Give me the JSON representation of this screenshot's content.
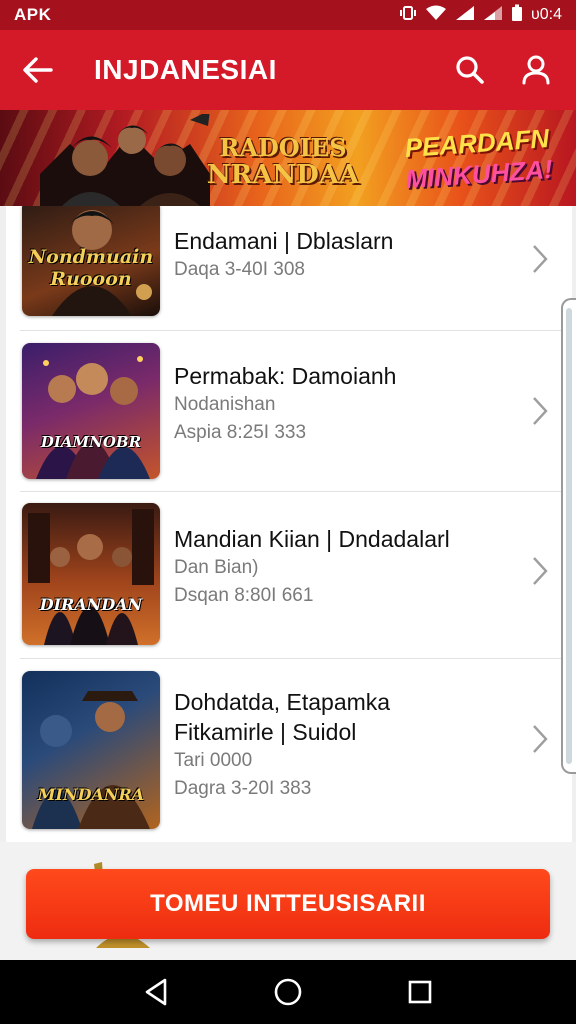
{
  "status_bar": {
    "left_text": "APK",
    "icons": [
      "vibrate-icon",
      "wifi-icon",
      "signal-icon",
      "signal-icon",
      "battery-icon"
    ],
    "time": "υ0:4"
  },
  "app_bar": {
    "title": "INJDANESIAI",
    "back_icon": "arrow-left-icon",
    "search_icon": "search-icon",
    "account_icon": "person-icon"
  },
  "banner": {
    "logo_line1": "RADOIES",
    "logo_line2": "NRANDAA",
    "promo_line1": "PEARDAFN",
    "promo_line2": "MINKUHZA!"
  },
  "list": {
    "items": [
      {
        "title": "Endamani | Dblaslarn",
        "line1": "Daqa 3-40I 308",
        "line2": "",
        "thumb_caption": "Nondmuain Ruooon",
        "thumb_colors": [
          "#2a1a14",
          "#7a3a1a"
        ]
      },
      {
        "title": "Permabak: Damoianh",
        "line1": "Nodanishan",
        "line2": "Aspia 8:25I 333",
        "thumb_caption": "DIAMNOBR",
        "thumb_colors": [
          "#3a1e6a",
          "#c4552a"
        ]
      },
      {
        "title": "Mandian Kiian | Dndadalarl",
        "line1": "Dan Bian)",
        "line2": "Dsqan 8:80I 661",
        "thumb_caption": "DIRANDAN",
        "thumb_colors": [
          "#3a1a12",
          "#d0702a"
        ]
      },
      {
        "title": "Dohdatda, Etapamka",
        "title2": "Fitkamirle | Suidol",
        "line1": "Tari 0000",
        "line2": "Dagra 3-20I 383",
        "thumb_caption": "MINDANRA",
        "thumb_colors": [
          "#12305a",
          "#b2641e"
        ]
      }
    ],
    "chevron_icon": "chevron-right-icon"
  },
  "cta": {
    "label": "TOMEU INTTEUSISARII"
  },
  "nav_bar": {
    "back_icon": "triangle-back-icon",
    "home_icon": "circle-home-icon",
    "recents_icon": "square-recents-icon"
  },
  "colors": {
    "status_bar": "#a5121d",
    "app_bar": "#d41a28",
    "cta": "#ee2c10"
  }
}
